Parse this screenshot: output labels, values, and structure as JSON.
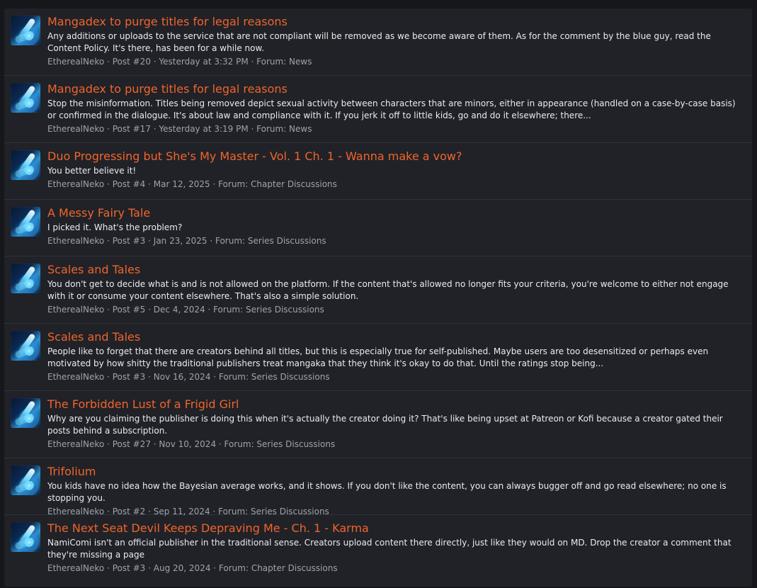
{
  "results": [
    {
      "title": "Mangadex to purge titles for legal reasons",
      "snippet": "Any additions or uploads to the service that are not compliant will be removed as we become aware of them. As for the comment by the blue guy, read the Content Policy. It's there, has been for a while now.",
      "author": "EtherealNeko",
      "post": "Post #20",
      "date": "Yesterday at 3:32 PM",
      "forum": "Forum: News"
    },
    {
      "title": "Mangadex to purge titles for legal reasons",
      "snippet": "Stop the misinformation. Titles being removed depict sexual activity between characters that are minors, either in appearance (handled on a case-by-case basis) or confirmed in the dialogue. It's about law and compliance with it. If you jerk it off to little kids, go and do it elsewhere; there...",
      "author": "EtherealNeko",
      "post": "Post #17",
      "date": "Yesterday at 3:19 PM",
      "forum": "Forum: News"
    },
    {
      "title": "Duo Progressing but She's My Master - Vol. 1 Ch. 1 - Wanna make a vow?",
      "snippet": "You better believe it!",
      "author": "EtherealNeko",
      "post": "Post #4",
      "date": "Mar 12, 2025",
      "forum": "Forum: Chapter Discussions"
    },
    {
      "title": "A Messy Fairy Tale",
      "snippet": "I picked it. What's the problem?",
      "author": "EtherealNeko",
      "post": "Post #3",
      "date": "Jan 23, 2025",
      "forum": "Forum: Series Discussions"
    },
    {
      "title": "Scales and Tales",
      "snippet": "You don't get to decide what is and is not allowed on the platform. If the content that's allowed no longer fits your criteria, you're welcome to either not engage with it or consume your content elsewhere. That's also a simple solution.",
      "author": "EtherealNeko",
      "post": "Post #5",
      "date": "Dec 4, 2024",
      "forum": "Forum: Series Discussions"
    },
    {
      "title": "Scales and Tales",
      "snippet": "People like to forget that there are creators behind all titles, but this is especially true for self-published. Maybe users are too desensitized or perhaps even motivated by how shitty the traditional publishers treat mangaka that they think it's okay to do that. Until the ratings stop being...",
      "author": "EtherealNeko",
      "post": "Post #3",
      "date": "Nov 16, 2024",
      "forum": "Forum: Series Discussions"
    },
    {
      "title": "The Forbidden Lust of a Frigid Girl",
      "snippet": "Why are you claiming the publisher is doing this when it's actually the creator doing it? That's like being upset at Patreon or Kofi because a creator gated their posts behind a subscription.",
      "author": "EtherealNeko",
      "post": "Post #27",
      "date": "Nov 10, 2024",
      "forum": "Forum: Series Discussions"
    },
    {
      "title": "Trifolium",
      "snippet": "You kids have no idea how the Bayesian average works, and it shows. If you don't like the content, you can always bugger off and go read elsewhere; no one is stopping you.",
      "author": "EtherealNeko",
      "post": "Post #2",
      "date": "Sep 11, 2024",
      "forum": "Forum: Series Discussions"
    },
    {
      "title": "The Next Seat Devil Keeps Depraving Me - Ch. 1 - Karma",
      "snippet": "NamiComi isn't an official publisher in the traditional sense. Creators upload content there directly, just like they would on MD. Drop the creator a comment that they're missing a page",
      "author": "EtherealNeko",
      "post": "Post #3",
      "date": "Aug 20, 2024",
      "forum": "Forum: Chapter Discussions"
    }
  ]
}
